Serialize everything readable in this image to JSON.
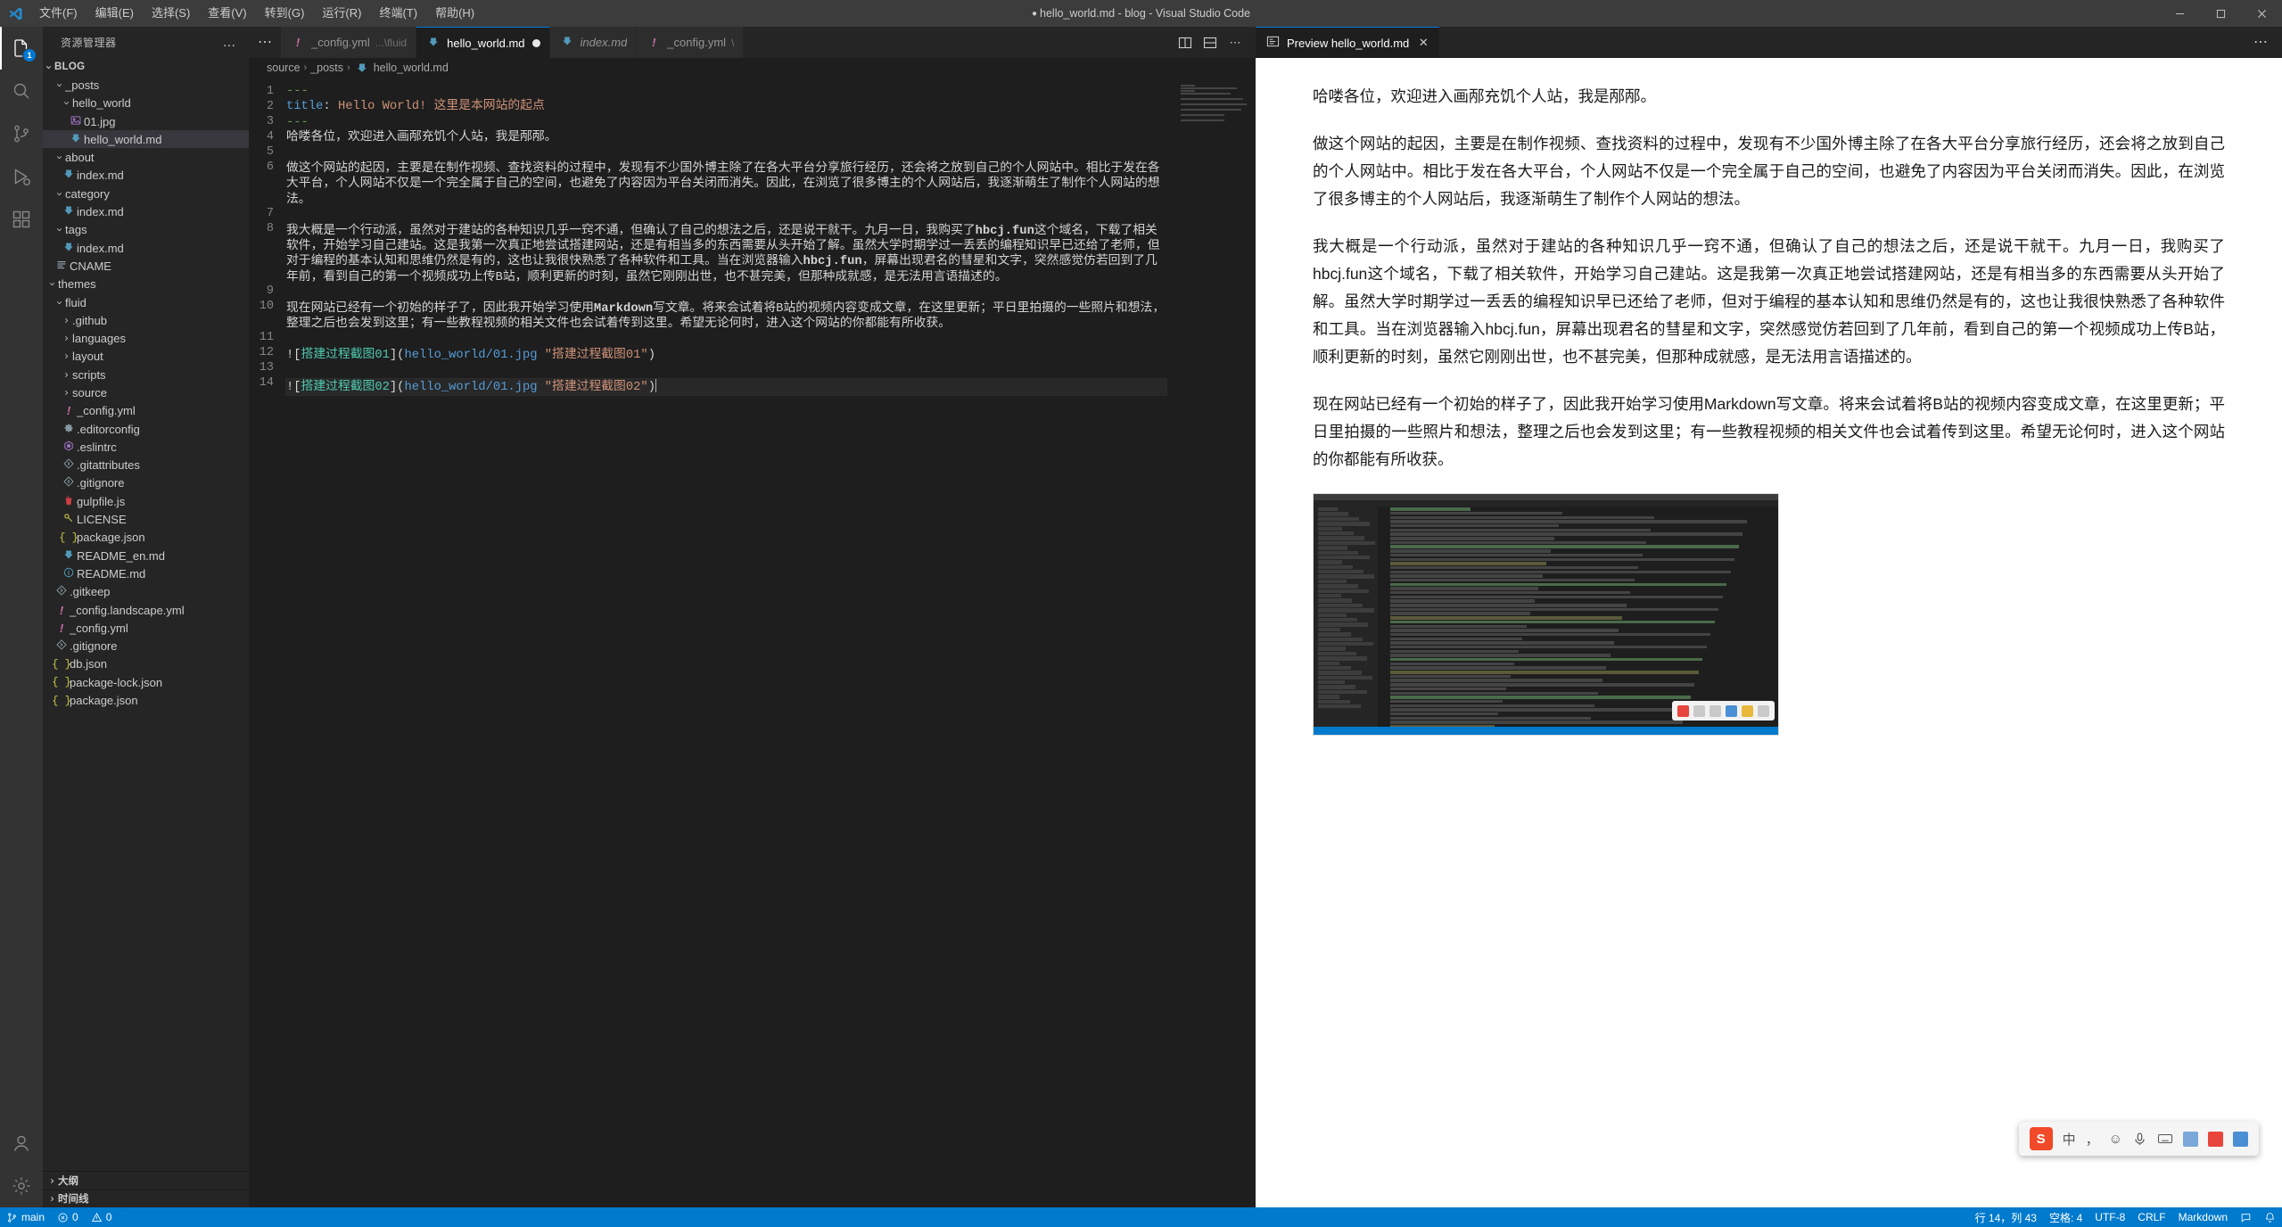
{
  "titlebar": {
    "title": "hello_world.md - blog - Visual Studio Code",
    "dirty_dot": "●",
    "menus": [
      {
        "label": "文件(F)",
        "name": "menu-file"
      },
      {
        "label": "编辑(E)",
        "name": "menu-edit"
      },
      {
        "label": "选择(S)",
        "name": "menu-selection"
      },
      {
        "label": "查看(V)",
        "name": "menu-view"
      },
      {
        "label": "转到(G)",
        "name": "menu-go"
      },
      {
        "label": "运行(R)",
        "name": "menu-run"
      },
      {
        "label": "终端(T)",
        "name": "menu-terminal"
      },
      {
        "label": "帮助(H)",
        "name": "menu-help"
      }
    ],
    "window_controls": [
      "minimize",
      "maximize",
      "close"
    ]
  },
  "activitybar": {
    "items": [
      {
        "name": "explorer",
        "icon": "files-icon",
        "active": true,
        "badge": "1"
      },
      {
        "name": "search",
        "icon": "search-icon",
        "active": false,
        "badge": ""
      },
      {
        "name": "source-control",
        "icon": "source-control-icon",
        "active": false,
        "badge": ""
      },
      {
        "name": "run-debug",
        "icon": "run-debug-icon",
        "active": false,
        "badge": ""
      },
      {
        "name": "extensions",
        "icon": "extensions-icon",
        "active": false,
        "badge": ""
      }
    ],
    "bottom_items": [
      {
        "name": "accounts",
        "icon": "account-icon"
      },
      {
        "name": "settings",
        "icon": "gear-icon"
      }
    ]
  },
  "sidebar": {
    "header_title": "资源管理器",
    "more_actions": "…",
    "root": {
      "label": "BLOG",
      "expanded": true
    },
    "tree": [
      {
        "label": "_posts",
        "depth": 1,
        "type": "folder",
        "expanded": true,
        "icon": "chevron-down-icon"
      },
      {
        "label": "hello_world",
        "depth": 2,
        "type": "folder",
        "expanded": true,
        "icon": "chevron-down-icon"
      },
      {
        "label": "01.jpg",
        "depth": 3,
        "type": "file",
        "icon": "image-icon"
      },
      {
        "label": "hello_world.md",
        "depth": 3,
        "type": "file",
        "icon": "markdown-icon",
        "selected": true
      },
      {
        "label": "about",
        "depth": 1,
        "type": "folder",
        "expanded": true,
        "icon": "chevron-down-icon"
      },
      {
        "label": "index.md",
        "depth": 2,
        "type": "file",
        "icon": "markdown-icon"
      },
      {
        "label": "category",
        "depth": 1,
        "type": "folder",
        "expanded": true,
        "icon": "chevron-down-icon"
      },
      {
        "label": "index.md",
        "depth": 2,
        "type": "file",
        "icon": "markdown-icon"
      },
      {
        "label": "tags",
        "depth": 1,
        "type": "folder",
        "expanded": true,
        "icon": "chevron-down-icon"
      },
      {
        "label": "index.md",
        "depth": 2,
        "type": "file",
        "icon": "markdown-icon"
      },
      {
        "label": "CNAME",
        "depth": 1,
        "type": "file",
        "icon": "lines-icon"
      },
      {
        "label": "themes",
        "depth": 0,
        "type": "folder",
        "expanded": true,
        "icon": "chevron-down-icon"
      },
      {
        "label": "fluid",
        "depth": 1,
        "type": "folder",
        "expanded": true,
        "icon": "chevron-down-icon"
      },
      {
        "label": ".github",
        "depth": 2,
        "type": "folder",
        "expanded": false,
        "icon": "chevron-right-icon"
      },
      {
        "label": "languages",
        "depth": 2,
        "type": "folder",
        "expanded": false,
        "icon": "chevron-right-icon"
      },
      {
        "label": "layout",
        "depth": 2,
        "type": "folder",
        "expanded": false,
        "icon": "chevron-right-icon"
      },
      {
        "label": "scripts",
        "depth": 2,
        "type": "folder",
        "expanded": false,
        "icon": "chevron-right-icon"
      },
      {
        "label": "source",
        "depth": 2,
        "type": "folder",
        "expanded": false,
        "icon": "chevron-right-icon"
      },
      {
        "label": "_config.yml",
        "depth": 2,
        "type": "file",
        "icon": "yaml-icon"
      },
      {
        "label": ".editorconfig",
        "depth": 2,
        "type": "file",
        "icon": "gear-icon"
      },
      {
        "label": ".eslintrc",
        "depth": 2,
        "type": "file",
        "icon": "eslint-icon"
      },
      {
        "label": ".gitattributes",
        "depth": 2,
        "type": "file",
        "icon": "git-icon"
      },
      {
        "label": ".gitignore",
        "depth": 2,
        "type": "file",
        "icon": "git-icon"
      },
      {
        "label": "gulpfile.js",
        "depth": 2,
        "type": "file",
        "icon": "gulp-icon"
      },
      {
        "label": "LICENSE",
        "depth": 2,
        "type": "file",
        "icon": "key-icon"
      },
      {
        "label": "package.json",
        "depth": 2,
        "type": "file",
        "icon": "json-icon"
      },
      {
        "label": "README_en.md",
        "depth": 2,
        "type": "file",
        "icon": "markdown-icon"
      },
      {
        "label": "README.md",
        "depth": 2,
        "type": "file",
        "icon": "info-icon"
      },
      {
        "label": ".gitkeep",
        "depth": 1,
        "type": "file",
        "icon": "git-icon"
      },
      {
        "label": "_config.landscape.yml",
        "depth": 1,
        "type": "file",
        "icon": "yaml-icon"
      },
      {
        "label": "_config.yml",
        "depth": 1,
        "type": "file",
        "icon": "yaml-icon"
      },
      {
        "label": ".gitignore",
        "depth": 1,
        "type": "file",
        "icon": "git-icon"
      },
      {
        "label": "db.json",
        "depth": 1,
        "type": "file",
        "icon": "json-icon"
      },
      {
        "label": "package-lock.json",
        "depth": 1,
        "type": "file",
        "icon": "json-icon"
      },
      {
        "label": "package.json",
        "depth": 1,
        "type": "file",
        "icon": "json-icon"
      }
    ],
    "bottom_sections": [
      {
        "label": "大纲",
        "name": "outline-section"
      },
      {
        "label": "时间线",
        "name": "timeline-section"
      }
    ]
  },
  "editor": {
    "tabs": [
      {
        "label": "_config.yml",
        "suffix": "...\\fluid",
        "icon": "yaml-icon",
        "active": false,
        "dirty": false,
        "italic": false
      },
      {
        "label": "hello_world.md",
        "suffix": "",
        "icon": "markdown-icon",
        "active": true,
        "dirty": true,
        "italic": false
      },
      {
        "label": "index.md",
        "suffix": "",
        "icon": "markdown-icon",
        "active": false,
        "dirty": false,
        "italic": true
      },
      {
        "label": "_config.yml",
        "suffix": "\\",
        "icon": "yaml-icon",
        "active": false,
        "dirty": false,
        "italic": false
      }
    ],
    "tab_actions": [
      "split-editor-right-icon",
      "split-editor-down-icon",
      "more-actions-icon"
    ],
    "breadcrumb": [
      "source",
      "_posts",
      "hello_world.md"
    ],
    "breadcrumb_separator": "›",
    "lines": [
      {
        "no": "1",
        "segs": [
          {
            "t": "---",
            "c": "tok-hr"
          }
        ]
      },
      {
        "no": "2",
        "segs": [
          {
            "t": "title",
            "c": "tok-key"
          },
          {
            "t": ": ",
            "c": "tok-plain"
          },
          {
            "t": "Hello World! 这里是本网站的起点",
            "c": "tok-str"
          }
        ]
      },
      {
        "no": "3",
        "segs": [
          {
            "t": "---",
            "c": "tok-hr"
          }
        ]
      },
      {
        "no": "4",
        "segs": [
          {
            "t": "哈喽各位，欢迎进入画邴充饥个人站，我是邴邴。",
            "c": "tok-plain"
          }
        ]
      },
      {
        "no": "5",
        "segs": [
          {
            "t": "",
            "c": "tok-plain"
          }
        ]
      },
      {
        "no": "6",
        "segs": [
          {
            "t": "做这个网站的起因，主要是在制作视频、查找资料的过程中，发现有不少国外博主除了在各大平台分享旅行经历，还会将之放到自己的个人网站中。相比于发在各大平台，个人网站不仅是一个完全属于自己的空间，也避免了内容因为平台关闭而消失。因此，在浏览了很多博主的个人网站后，我逐渐萌生了制作个人网站的想法。",
            "c": "tok-plain"
          }
        ]
      },
      {
        "no": "7",
        "segs": [
          {
            "t": "",
            "c": "tok-plain"
          }
        ]
      },
      {
        "no": "8",
        "segs": [
          {
            "t": "我大概是一个行动派，虽然对于建站的各种知识几乎一窍不通，但确认了自己的想法之后，还是说干就干。九月一日，我购买了",
            "c": "tok-plain"
          },
          {
            "t": "hbcj.fun",
            "c": "tok-bold"
          },
          {
            "t": "这个域名，下载了相关软件，开始学习自己建站。这是我第一次真正地尝试搭建网站，还是有相当多的东西需要从头开始了解。虽然大学时期学过一丢丢的编程知识早已还给了老师，但对于编程的基本认知和思维仍然是有的，这也让我很快熟悉了各种软件和工具。当在浏览器输入",
            "c": "tok-plain"
          },
          {
            "t": "hbcj.fun",
            "c": "tok-bold"
          },
          {
            "t": "，屏幕出现君名的彗星和文字，突然感觉仿若回到了几年前，看到自己的第一个视频成功上传B站，顺利更新的时刻，虽然它刚刚出世，也不甚完美，但那种成就感，是无法用言语描述的。",
            "c": "tok-plain"
          }
        ]
      },
      {
        "no": "9",
        "segs": [
          {
            "t": "",
            "c": "tok-plain"
          }
        ]
      },
      {
        "no": "10",
        "segs": [
          {
            "t": "现在网站已经有一个初始的样子了，因此我开始学习使用",
            "c": "tok-plain"
          },
          {
            "t": "Markdown",
            "c": "tok-bold"
          },
          {
            "t": "写文章。将来会试着将B站的视频内容变成文章，在这里更新；平日里拍摄的一些照片和想法，整理之后也会发到这里；有一些教程视频的相关文件也会试着传到这里。希望无论何时，进入这个网站的你都能有所收获。",
            "c": "tok-plain"
          }
        ]
      },
      {
        "no": "11",
        "segs": [
          {
            "t": "",
            "c": "tok-plain"
          }
        ]
      },
      {
        "no": "12",
        "segs": [
          {
            "t": "![",
            "c": "tok-brack"
          },
          {
            "t": "搭建过程截图01",
            "c": "tok-link"
          },
          {
            "t": "](",
            "c": "tok-brack"
          },
          {
            "t": "hello_world/01.jpg",
            "c": "tok-alt"
          },
          {
            "t": " \"搭建过程截图01\"",
            "c": "tok-url"
          },
          {
            "t": ")",
            "c": "tok-brack"
          }
        ]
      },
      {
        "no": "13",
        "segs": [
          {
            "t": "",
            "c": "tok-plain"
          }
        ]
      },
      {
        "no": "14",
        "segs": [
          {
            "t": "![",
            "c": "tok-brack"
          },
          {
            "t": "搭建过程截图02",
            "c": "tok-link"
          },
          {
            "t": "](",
            "c": "tok-brack"
          },
          {
            "t": "hello_world/01.jpg",
            "c": "tok-alt"
          },
          {
            "t": " \"搭建过程截图02\"",
            "c": "tok-url"
          },
          {
            "t": ")",
            "c": "tok-brack"
          }
        ],
        "current": true
      }
    ]
  },
  "preview": {
    "tab_label": "Preview hello_world.md",
    "tab_icon": "preview-icon",
    "close_icon": "close-icon",
    "more_icon": "more-actions-icon",
    "paragraphs": [
      "哈喽各位，欢迎进入画邴充饥个人站，我是邴邴。",
      "做这个网站的起因，主要是在制作视频、查找资料的过程中，发现有不少国外博主除了在各大平台分享旅行经历，还会将之放到自己的个人网站中。相比于发在各大平台，个人网站不仅是一个完全属于自己的空间，也避免了内容因为平台关闭而消失。因此，在浏览了很多博主的个人网站后，我逐渐萌生了制作个人网站的想法。",
      "我大概是一个行动派，虽然对于建站的各种知识几乎一窍不通，但确认了自己的想法之后，还是说干就干。九月一日，我购买了hbcj.fun这个域名，下载了相关软件，开始学习自己建站。这是我第一次真正地尝试搭建网站，还是有相当多的东西需要从头开始了解。虽然大学时期学过一丢丢的编程知识早已还给了老师，但对于编程的基本认知和思维仍然是有的，这也让我很快熟悉了各种软件和工具。当在浏览器输入hbcj.fun，屏幕出现君名的彗星和文字，突然感觉仿若回到了几年前，看到自己的第一个视频成功上传B站，顺利更新的时刻，虽然它刚刚出世，也不甚完美，但那种成就感，是无法用言语描述的。",
      "现在网站已经有一个初始的样子了，因此我开始学习使用Markdown写文章。将来会试着将B站的视频内容变成文章，在这里更新；平日里拍摄的一些照片和想法，整理之后也会发到这里；有一些教程视频的相关文件也会试着传到这里。希望无论何时，进入这个网站的你都能有所收获。"
    ],
    "image_alt": "搭建过程截图01"
  },
  "ime": {
    "logo": "S",
    "lang": "中",
    "items": [
      "punctuation-icon",
      "emoji-icon",
      "mic-icon",
      "keyboard-icon",
      "toolbox-icon",
      "cart-icon",
      "grid-icon"
    ]
  },
  "statusbar": {
    "left": [
      {
        "label": "main",
        "icon": "source-control-branch-icon",
        "name": "status-branch"
      },
      {
        "label": "0",
        "icon": "error-icon",
        "name": "status-errors"
      },
      {
        "label": "0",
        "icon": "warning-icon",
        "name": "status-warnings"
      }
    ],
    "right": [
      {
        "label": "行 14，列 43",
        "name": "status-cursor-position"
      },
      {
        "label": "空格: 4",
        "name": "status-indentation"
      },
      {
        "label": "UTF-8",
        "name": "status-encoding"
      },
      {
        "label": "CRLF",
        "name": "status-eol"
      },
      {
        "label": "Markdown",
        "name": "status-language-mode"
      },
      {
        "label": "",
        "icon": "bell-icon",
        "name": "status-notifications"
      },
      {
        "label": "",
        "icon": "feedback-icon",
        "name": "status-feedback"
      }
    ]
  },
  "colors": {
    "accent": "#007acc",
    "titlebar_bg": "#3c3c3c",
    "sidebar_bg": "#252526",
    "editor_bg": "#1e1e1e",
    "activitybar_bg": "#333333",
    "preview_bg": "#ffffff"
  }
}
